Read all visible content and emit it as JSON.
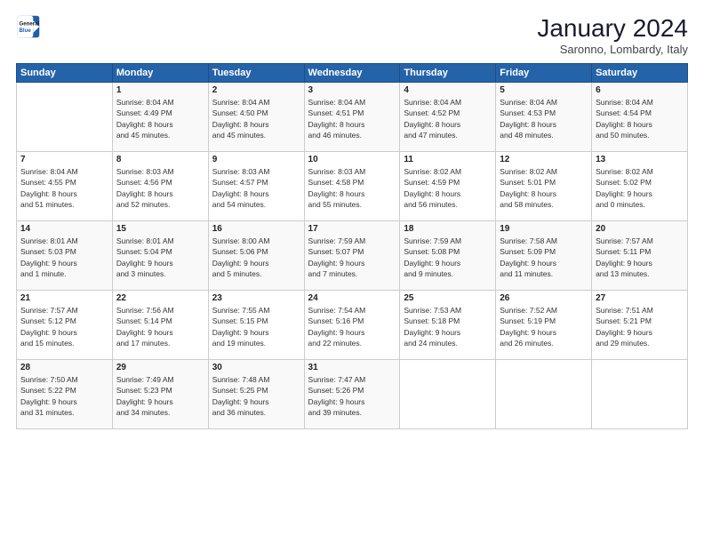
{
  "logo": {
    "line1": "General",
    "line2": "Blue"
  },
  "title": "January 2024",
  "subtitle": "Saronno, Lombardy, Italy",
  "weekdays": [
    "Sunday",
    "Monday",
    "Tuesday",
    "Wednesday",
    "Thursday",
    "Friday",
    "Saturday"
  ],
  "weeks": [
    [
      {
        "day": "",
        "info": ""
      },
      {
        "day": "1",
        "info": "Sunrise: 8:04 AM\nSunset: 4:49 PM\nDaylight: 8 hours\nand 45 minutes."
      },
      {
        "day": "2",
        "info": "Sunrise: 8:04 AM\nSunset: 4:50 PM\nDaylight: 8 hours\nand 45 minutes."
      },
      {
        "day": "3",
        "info": "Sunrise: 8:04 AM\nSunset: 4:51 PM\nDaylight: 8 hours\nand 46 minutes."
      },
      {
        "day": "4",
        "info": "Sunrise: 8:04 AM\nSunset: 4:52 PM\nDaylight: 8 hours\nand 47 minutes."
      },
      {
        "day": "5",
        "info": "Sunrise: 8:04 AM\nSunset: 4:53 PM\nDaylight: 8 hours\nand 48 minutes."
      },
      {
        "day": "6",
        "info": "Sunrise: 8:04 AM\nSunset: 4:54 PM\nDaylight: 8 hours\nand 50 minutes."
      }
    ],
    [
      {
        "day": "7",
        "info": "Sunrise: 8:04 AM\nSunset: 4:55 PM\nDaylight: 8 hours\nand 51 minutes."
      },
      {
        "day": "8",
        "info": "Sunrise: 8:03 AM\nSunset: 4:56 PM\nDaylight: 8 hours\nand 52 minutes."
      },
      {
        "day": "9",
        "info": "Sunrise: 8:03 AM\nSunset: 4:57 PM\nDaylight: 8 hours\nand 54 minutes."
      },
      {
        "day": "10",
        "info": "Sunrise: 8:03 AM\nSunset: 4:58 PM\nDaylight: 8 hours\nand 55 minutes."
      },
      {
        "day": "11",
        "info": "Sunrise: 8:02 AM\nSunset: 4:59 PM\nDaylight: 8 hours\nand 56 minutes."
      },
      {
        "day": "12",
        "info": "Sunrise: 8:02 AM\nSunset: 5:01 PM\nDaylight: 8 hours\nand 58 minutes."
      },
      {
        "day": "13",
        "info": "Sunrise: 8:02 AM\nSunset: 5:02 PM\nDaylight: 9 hours\nand 0 minutes."
      }
    ],
    [
      {
        "day": "14",
        "info": "Sunrise: 8:01 AM\nSunset: 5:03 PM\nDaylight: 9 hours\nand 1 minute."
      },
      {
        "day": "15",
        "info": "Sunrise: 8:01 AM\nSunset: 5:04 PM\nDaylight: 9 hours\nand 3 minutes."
      },
      {
        "day": "16",
        "info": "Sunrise: 8:00 AM\nSunset: 5:06 PM\nDaylight: 9 hours\nand 5 minutes."
      },
      {
        "day": "17",
        "info": "Sunrise: 7:59 AM\nSunset: 5:07 PM\nDaylight: 9 hours\nand 7 minutes."
      },
      {
        "day": "18",
        "info": "Sunrise: 7:59 AM\nSunset: 5:08 PM\nDaylight: 9 hours\nand 9 minutes."
      },
      {
        "day": "19",
        "info": "Sunrise: 7:58 AM\nSunset: 5:09 PM\nDaylight: 9 hours\nand 11 minutes."
      },
      {
        "day": "20",
        "info": "Sunrise: 7:57 AM\nSunset: 5:11 PM\nDaylight: 9 hours\nand 13 minutes."
      }
    ],
    [
      {
        "day": "21",
        "info": "Sunrise: 7:57 AM\nSunset: 5:12 PM\nDaylight: 9 hours\nand 15 minutes."
      },
      {
        "day": "22",
        "info": "Sunrise: 7:56 AM\nSunset: 5:14 PM\nDaylight: 9 hours\nand 17 minutes."
      },
      {
        "day": "23",
        "info": "Sunrise: 7:55 AM\nSunset: 5:15 PM\nDaylight: 9 hours\nand 19 minutes."
      },
      {
        "day": "24",
        "info": "Sunrise: 7:54 AM\nSunset: 5:16 PM\nDaylight: 9 hours\nand 22 minutes."
      },
      {
        "day": "25",
        "info": "Sunrise: 7:53 AM\nSunset: 5:18 PM\nDaylight: 9 hours\nand 24 minutes."
      },
      {
        "day": "26",
        "info": "Sunrise: 7:52 AM\nSunset: 5:19 PM\nDaylight: 9 hours\nand 26 minutes."
      },
      {
        "day": "27",
        "info": "Sunrise: 7:51 AM\nSunset: 5:21 PM\nDaylight: 9 hours\nand 29 minutes."
      }
    ],
    [
      {
        "day": "28",
        "info": "Sunrise: 7:50 AM\nSunset: 5:22 PM\nDaylight: 9 hours\nand 31 minutes."
      },
      {
        "day": "29",
        "info": "Sunrise: 7:49 AM\nSunset: 5:23 PM\nDaylight: 9 hours\nand 34 minutes."
      },
      {
        "day": "30",
        "info": "Sunrise: 7:48 AM\nSunset: 5:25 PM\nDaylight: 9 hours\nand 36 minutes."
      },
      {
        "day": "31",
        "info": "Sunrise: 7:47 AM\nSunset: 5:26 PM\nDaylight: 9 hours\nand 39 minutes."
      },
      {
        "day": "",
        "info": ""
      },
      {
        "day": "",
        "info": ""
      },
      {
        "day": "",
        "info": ""
      }
    ]
  ]
}
